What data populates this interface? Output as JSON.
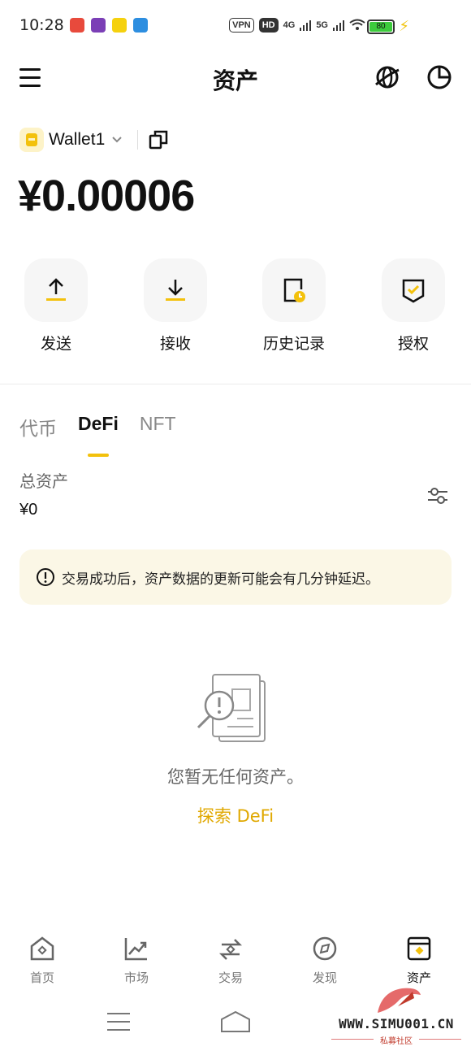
{
  "status_bar": {
    "time": "10:28",
    "vpn": "VPN",
    "hd": "HD",
    "net1": "4G",
    "net2": "5G",
    "battery": "80"
  },
  "header": {
    "title": "资产",
    "icons": [
      "menu-icon",
      "globe-icon",
      "pie-chart-icon"
    ]
  },
  "wallet": {
    "name": "Wallet1",
    "balance": "¥0.00006"
  },
  "actions": [
    {
      "label": "发送",
      "icon": "upload-icon"
    },
    {
      "label": "接收",
      "icon": "download-icon"
    },
    {
      "label": "历史记录",
      "icon": "history-icon"
    },
    {
      "label": "授权",
      "icon": "authorize-icon"
    }
  ],
  "tabs": [
    {
      "label": "代币",
      "active": false
    },
    {
      "label": "DeFi",
      "active": true
    },
    {
      "label": "NFT",
      "active": false
    }
  ],
  "summary": {
    "total_label": "总资产",
    "total_value": "¥0"
  },
  "notice": {
    "text": "交易成功后，资产数据的更新可能会有几分钟延迟。"
  },
  "empty_state": {
    "message": "您暂无任何资产。",
    "link": "探索 DeFi"
  },
  "bottom_nav": [
    {
      "label": "首页",
      "icon": "home-icon"
    },
    {
      "label": "市场",
      "icon": "market-icon"
    },
    {
      "label": "交易",
      "icon": "trade-icon"
    },
    {
      "label": "发现",
      "icon": "discover-icon"
    },
    {
      "label": "资产",
      "icon": "assets-icon",
      "active": true
    }
  ],
  "watermark": {
    "text": "WWW.SIMU001.CN",
    "sub": "私募社区"
  },
  "colors": {
    "accent": "#f3c10c",
    "link": "#e0a800",
    "notice_bg": "#fbf7e6"
  }
}
